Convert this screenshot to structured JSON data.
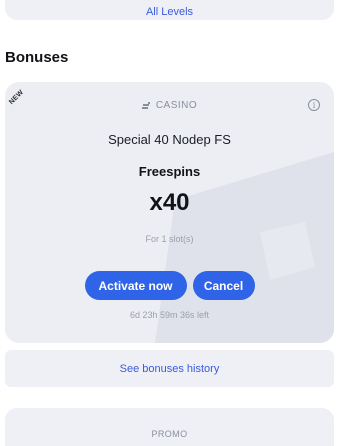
{
  "top_card": {
    "link_label": "All Levels"
  },
  "bonuses_section": {
    "title": "Bonuses"
  },
  "bonus": {
    "tag": "NEW",
    "category": "CASINO",
    "category_icon": "casino-chips-icon",
    "info_icon": "info-icon",
    "name": "Special 40 Nodep FS",
    "type": "Freespins",
    "multiplier": "x40",
    "slots": "For 1 slot(s)",
    "activate_label": "Activate now",
    "cancel_label": "Cancel",
    "time_left": "6d 23h 59m 36s left"
  },
  "history": {
    "link_label": "See bonuses history"
  },
  "promo": {
    "label": "PROMO"
  },
  "colors": {
    "accent": "#2f63e8",
    "link": "#3b5bdb",
    "card_bg": "#eceef4",
    "muted_text": "#9aa0ac"
  }
}
